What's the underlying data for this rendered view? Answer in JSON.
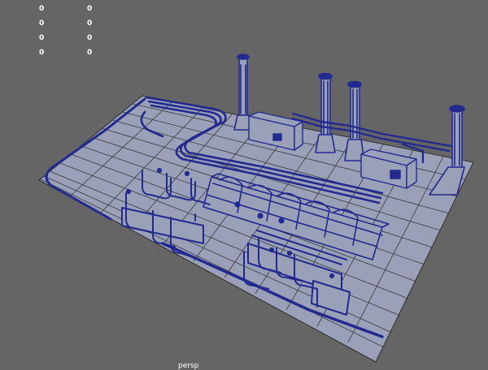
{
  "viewport": {
    "camera_name": "persp",
    "background_color": "#656565",
    "grid_color": "#9aa0b8",
    "grid_line_color": "#3b3b3b",
    "wireframe_color": "#232a8f"
  },
  "hud": {
    "rows": [
      {
        "label": "0",
        "value": "0"
      },
      {
        "label": "0",
        "value": "0"
      },
      {
        "label": "0",
        "value": "0"
      },
      {
        "label": "0",
        "value": "0"
      }
    ]
  }
}
